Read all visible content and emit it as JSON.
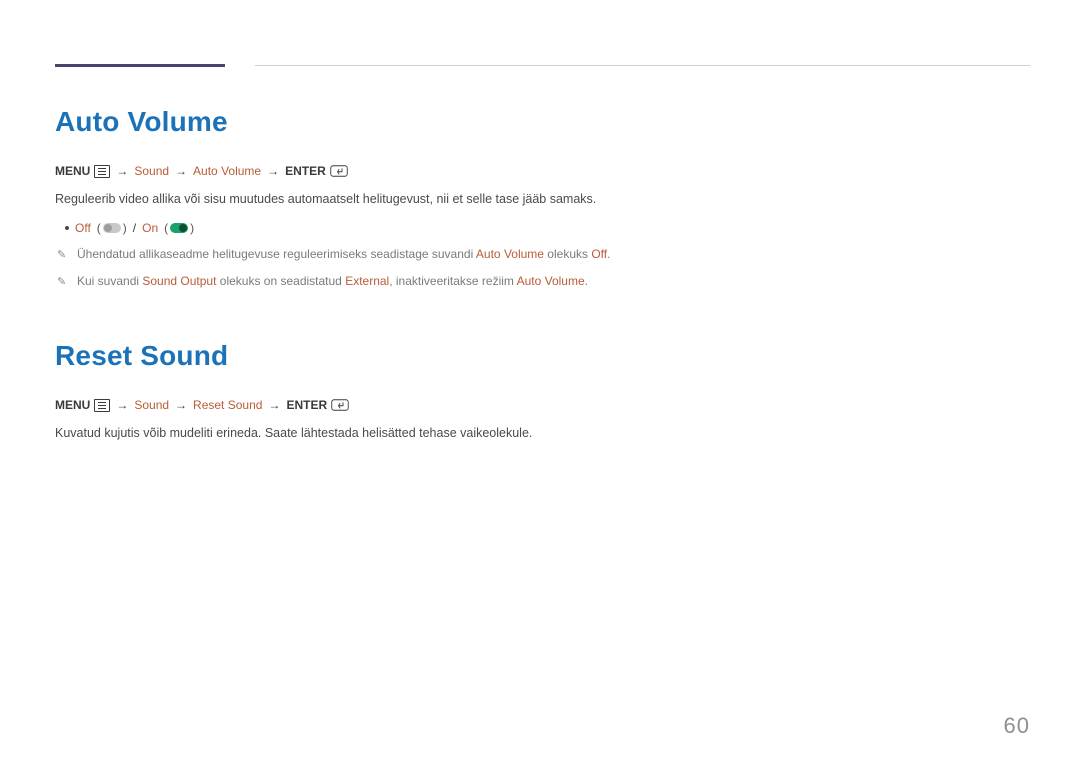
{
  "page_number": "60",
  "sections": {
    "auto_volume": {
      "title": "Auto Volume",
      "breadcrumb": {
        "menu": "MENU",
        "arrow": "→",
        "path1": "Sound",
        "path2": "Auto Volume",
        "enter": "ENTER"
      },
      "description": "Reguleerib video allika või sisu muutudes automaatselt helitugevust, nii et selle tase jääb samaks.",
      "option_off": "Off",
      "option_sep": " / ",
      "option_on": "On",
      "note1_pre": "Ühendatud allikaseadme helitugevuse reguleerimiseks seadistage suvandi ",
      "note1_link": "Auto Volume",
      "note1_mid": " olekuks ",
      "note1_off": "Off",
      "note1_end": ".",
      "note2_pre": "Kui suvandi ",
      "note2_link1": "Sound Output",
      "note2_mid1": " olekuks on seadistatud ",
      "note2_link2": "External",
      "note2_mid2": ", inaktiveeritakse režiim ",
      "note2_link3": "Auto Volume",
      "note2_end": "."
    },
    "reset_sound": {
      "title": "Reset Sound",
      "breadcrumb": {
        "menu": "MENU",
        "arrow": "→",
        "path1": "Sound",
        "path2": "Reset Sound",
        "enter": "ENTER"
      },
      "description": "Kuvatud kujutis võib mudeliti erineda. Saate lähtestada helisätted tehase vaikeolekule."
    }
  }
}
